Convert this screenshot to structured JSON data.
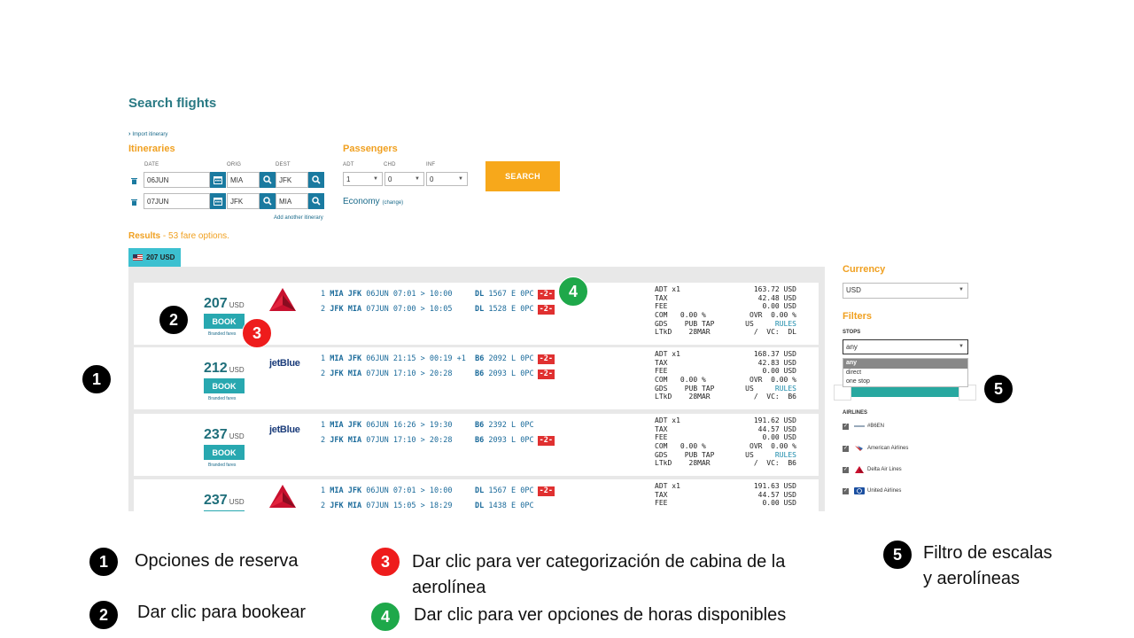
{
  "page": {
    "title": "Search flights",
    "import_link": "Import itinerary"
  },
  "itineraries": {
    "title": "Itineraries",
    "col_date": "DATE",
    "col_orig": "ORIG",
    "col_dest": "DEST",
    "rows": [
      {
        "date": "06JUN",
        "orig": "MIA",
        "dest": "JFK"
      },
      {
        "date": "07JUN",
        "orig": "JFK",
        "dest": "MIA"
      }
    ],
    "add_link": "Add another itinerary"
  },
  "passengers": {
    "title": "Passengers",
    "adt_label": "ADT",
    "chd_label": "CHD",
    "inf_label": "INF",
    "adt": "1",
    "chd": "0",
    "inf": "0",
    "cabin": "Economy",
    "change_link": "(change)"
  },
  "search_button": "SEARCH",
  "results": {
    "label": "Results",
    "count_text": "- 53 fare options.",
    "tab_price": "207 USD"
  },
  "fares": [
    {
      "price": "207",
      "currency": "USD",
      "book": "BOOK",
      "branded": "Branded fares",
      "airline": "delta",
      "segments": [
        {
          "num": "1",
          "route": "MIA JFK",
          "date": "06JUN",
          "time": "07:01 > 10:00",
          "extra": "",
          "carrier": "DL",
          "detail": "1567 E 0PC",
          "badge": "-2-"
        },
        {
          "num": "2",
          "route": "JFK MIA",
          "date": "07JUN",
          "time": "07:00 > 10:05",
          "extra": "",
          "carrier": "DL",
          "detail": "1528 E 0PC",
          "badge": "-2-"
        }
      ],
      "breakdown": {
        "adt": "ADT x1",
        "base": "163.72 USD",
        "tax": "42.48 USD",
        "fee": "0.00 USD",
        "com": "COM   0.00 %",
        "ovr": "OVR  0.00 %",
        "gds": "GDS    PUB TAP",
        "us": "US",
        "rules": "RULES",
        "ltkd": "LTkD    28MAR",
        "vc": "/  VC:  DL"
      }
    },
    {
      "price": "212",
      "currency": "USD",
      "book": "BOOK",
      "branded": "Branded fares",
      "airline": "jetBlue",
      "segments": [
        {
          "num": "1",
          "route": "MIA JFK",
          "date": "06JUN",
          "time": "21:15 > 00:19",
          "extra": "+1",
          "carrier": "B6",
          "detail": "2092 L 0PC",
          "badge": "-2-"
        },
        {
          "num": "2",
          "route": "JFK MIA",
          "date": "07JUN",
          "time": "17:10 > 20:28",
          "extra": "",
          "carrier": "B6",
          "detail": "2093 L 0PC",
          "badge": "-2-"
        }
      ],
      "breakdown": {
        "adt": "ADT x1",
        "base": "168.37 USD",
        "tax": "42.83 USD",
        "fee": "0.00 USD",
        "com": "COM   0.00 %",
        "ovr": "OVR  0.00 %",
        "gds": "GDS    PUB TAP",
        "us": "US",
        "rules": "RULES",
        "ltkd": "LTkD    28MAR",
        "vc": "/  VC:  B6"
      }
    },
    {
      "price": "237",
      "currency": "USD",
      "book": "BOOK",
      "branded": "Branded fares",
      "airline": "jetBlue",
      "segments": [
        {
          "num": "1",
          "route": "MIA JFK",
          "date": "06JUN",
          "time": "16:26 > 19:30",
          "extra": "",
          "carrier": "B6",
          "detail": "2392 L 0PC",
          "badge": ""
        },
        {
          "num": "2",
          "route": "JFK MIA",
          "date": "07JUN",
          "time": "17:10 > 20:28",
          "extra": "",
          "carrier": "B6",
          "detail": "2093 L 0PC",
          "badge": "-2-"
        }
      ],
      "breakdown": {
        "adt": "ADT x1",
        "base": "191.62 USD",
        "tax": "44.57 USD",
        "fee": "0.00 USD",
        "com": "COM   0.00 %",
        "ovr": "OVR  0.00 %",
        "gds": "GDS    PUB TAP",
        "us": "US",
        "rules": "RULES",
        "ltkd": "LTkD    28MAR",
        "vc": "/  VC:  B6"
      }
    },
    {
      "price": "237",
      "currency": "USD",
      "book": "BOOK",
      "branded": "",
      "airline": "delta",
      "segments": [
        {
          "num": "1",
          "route": "MIA JFK",
          "date": "06JUN",
          "time": "07:01 > 10:00",
          "extra": "",
          "carrier": "DL",
          "detail": "1567 E 0PC",
          "badge": "-2-"
        },
        {
          "num": "2",
          "route": "JFK MIA",
          "date": "07JUN",
          "time": "15:05 > 18:29",
          "extra": "",
          "carrier": "DL",
          "detail": "1438 E 0PC",
          "badge": ""
        }
      ],
      "breakdown": {
        "adt": "ADT x1",
        "base": "191.63 USD",
        "tax": "44.57 USD",
        "fee": "0.00 USD",
        "com": "",
        "ovr": "",
        "gds": "",
        "us": "",
        "rules": "",
        "ltkd": "",
        "vc": ""
      }
    }
  ],
  "sidebar": {
    "currency_title": "Currency",
    "currency_value": "USD",
    "filters_title": "Filters",
    "stops_label": "STOPS",
    "stops_value": "any",
    "stops_options": [
      "any",
      "direct",
      "one stop"
    ],
    "airlines_label": "AIRLINES",
    "airlines": [
      "#B6EN",
      "American Airlines",
      "Delta Air Lines",
      "United Airlines"
    ]
  },
  "markers": {
    "m1": "1",
    "m2": "2",
    "m3": "3",
    "m4": "4",
    "m5": "5"
  },
  "legend": {
    "l1": "Opciones de reserva",
    "l2": "Dar clic para bookear",
    "l3a": "Dar clic para ver categorización de cabina de la",
    "l3b": "aerolínea",
    "l4": "Dar clic para ver opciones de horas disponibles",
    "l5a": "Filtro de escalas",
    "l5b": "y aerolíneas"
  },
  "colors": {
    "teal": "#28a8b0",
    "orange": "#f7a81b",
    "link": "#1a6a8a",
    "badge_red": "#e03030"
  }
}
